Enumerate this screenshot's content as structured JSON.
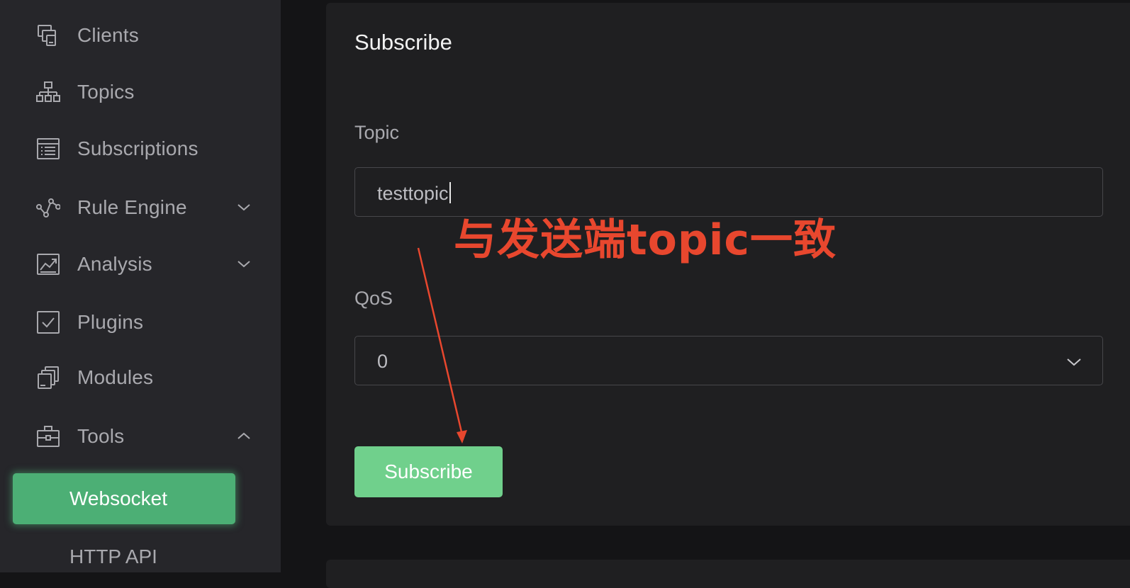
{
  "sidebar": {
    "items": [
      {
        "label": "Clients",
        "icon": "clients-icon"
      },
      {
        "label": "Topics",
        "icon": "topics-icon"
      },
      {
        "label": "Subscriptions",
        "icon": "subscriptions-icon"
      },
      {
        "label": "Rule Engine",
        "icon": "rule-engine-icon",
        "chevron": "down"
      },
      {
        "label": "Analysis",
        "icon": "analysis-icon",
        "chevron": "down"
      },
      {
        "label": "Plugins",
        "icon": "plugins-icon"
      },
      {
        "label": "Modules",
        "icon": "modules-icon"
      },
      {
        "label": "Tools",
        "icon": "tools-icon",
        "chevron": "up"
      }
    ],
    "tools_children": [
      {
        "label": "Websocket",
        "active": true
      },
      {
        "label": "HTTP API",
        "active": false
      }
    ]
  },
  "subscribe_card": {
    "title": "Subscribe",
    "topic_label": "Topic",
    "topic_value": "testtopic",
    "qos_label": "QoS",
    "qos_value": "0",
    "button_label": "Subscribe"
  },
  "annotation": {
    "text": "与发送端topic一致",
    "color": "#e8472e"
  },
  "colors": {
    "accent": "#4caf75",
    "button": "#70d08c",
    "sidebar_bg": "#26262a",
    "card_bg": "#1f1f21"
  }
}
